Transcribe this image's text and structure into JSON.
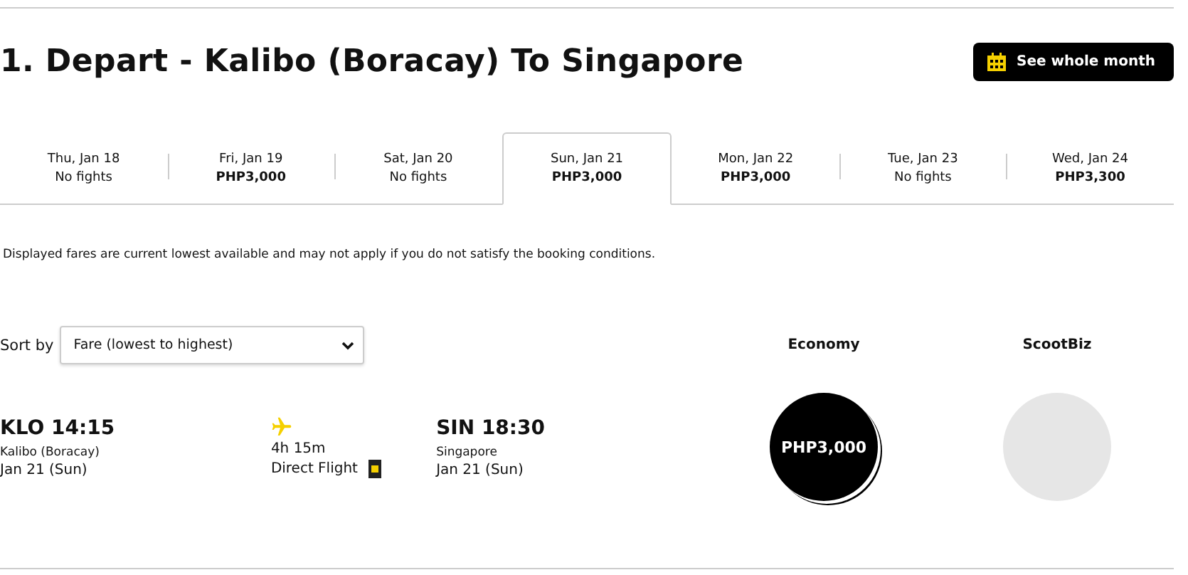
{
  "heading": "1. Depart - Kalibo (Boracay) To Singapore",
  "month_button": {
    "label": "See whole month"
  },
  "date_tabs": [
    {
      "date": "Thu, Jan 18",
      "fare": "No fights",
      "kind": "none",
      "selected": false
    },
    {
      "date": "Fri, Jan 19",
      "fare": "PHP3,000",
      "kind": "price",
      "selected": false
    },
    {
      "date": "Sat, Jan 20",
      "fare": "No fights",
      "kind": "none",
      "selected": false
    },
    {
      "date": "Sun, Jan 21",
      "fare": "PHP3,000",
      "kind": "price",
      "selected": true
    },
    {
      "date": "Mon, Jan 22",
      "fare": "PHP3,000",
      "kind": "price",
      "selected": false
    },
    {
      "date": "Tue, Jan 23",
      "fare": "No fights",
      "kind": "none",
      "selected": false
    },
    {
      "date": "Wed, Jan 24",
      "fare": "PHP3,300",
      "kind": "price",
      "selected": false
    }
  ],
  "notice": "Displayed fares are current lowest available and may not apply if you do not satisfy the booking conditions.",
  "sort": {
    "label": "Sort by",
    "value": "Fare (lowest to highest)"
  },
  "fare_columns": [
    {
      "label": "Economy"
    },
    {
      "label": "ScootBiz"
    }
  ],
  "flights": [
    {
      "depart": {
        "code_time": "KLO 14:15",
        "city": "Kalibo (Boracay)",
        "date": "Jan 21 (Sun)"
      },
      "duration": "4h 15m",
      "stops": "Direct Flight",
      "arrive": {
        "code_time": "SIN 18:30",
        "city": "Singapore",
        "date": "Jan 21 (Sun)"
      },
      "fares": [
        {
          "price": "PHP3,000",
          "available": true
        },
        {
          "available": false
        }
      ]
    }
  ]
}
